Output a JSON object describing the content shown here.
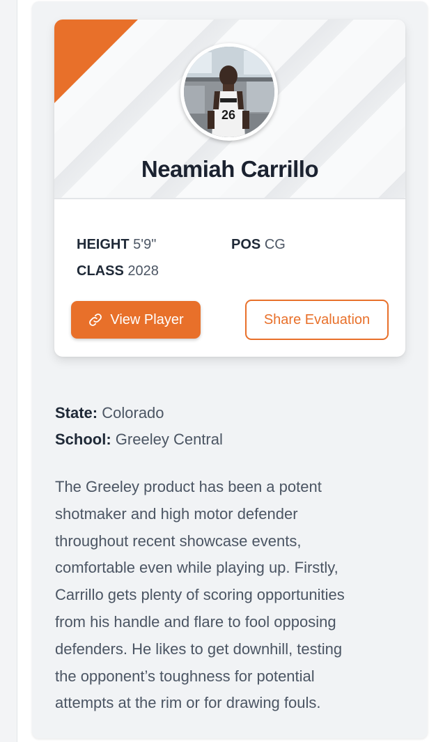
{
  "player": {
    "name": "Neamiah Carrillo",
    "avatar_alt": "player photo"
  },
  "stats": {
    "height_label": "HEIGHT",
    "height_value": "5'9\"",
    "pos_label": "POS",
    "pos_value": "CG",
    "class_label": "CLASS",
    "class_value": "2028"
  },
  "actions": {
    "view_player_label": "View Player",
    "view_player_icon": "link-icon",
    "share_label": "Share Evaluation"
  },
  "info": {
    "state_label": "State:",
    "state_value": "Colorado",
    "school_label": "School:",
    "school_value": "Greeley Central"
  },
  "bio": {
    "lines": [
      "The Greeley product has been a potent",
      "shotmaker and high motor defender",
      "throughout recent showcase events,",
      "comfortable even while playing up. Firstly,",
      "Carrillo gets plenty of scoring opportunities",
      "from his handle and flare to fool opposing",
      "defenders. He likes to get downhill, testing",
      "the opponent’s toughness for potential",
      "attempts at the rim or for drawing fouls."
    ]
  },
  "colors": {
    "accent": "#e8702a",
    "heading": "#1b2230",
    "body_text": "#4b5563",
    "panel_bg": "#f1f3f5"
  }
}
